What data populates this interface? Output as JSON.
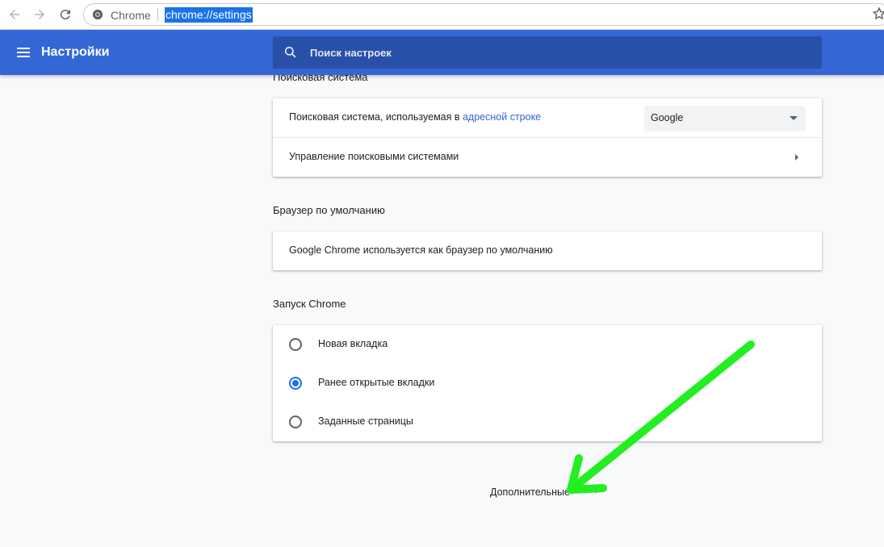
{
  "browser": {
    "site_name": "Chrome",
    "url": "chrome://settings"
  },
  "header": {
    "title": "Настройки",
    "search_placeholder": "Поиск настроек"
  },
  "search_engine": {
    "section_title": "Поисковая система",
    "row1_text": "Поисковая система, используемая в",
    "row1_link": "адресной строке",
    "select_value": "Google",
    "row2_text": "Управление поисковыми системами"
  },
  "default_browser": {
    "section_title": "Браузер по умолчанию",
    "text": "Google Chrome используется как браузер по умолчанию"
  },
  "startup": {
    "section_title": "Запуск Chrome",
    "options": [
      {
        "label": "Новая вкладка",
        "checked": false
      },
      {
        "label": "Ранее открытые вкладки",
        "checked": true
      },
      {
        "label": "Заданные страницы",
        "checked": false
      }
    ]
  },
  "advanced": {
    "label": "Дополнительные"
  },
  "colors": {
    "header_bg": "#3367d6",
    "search_bg": "#2850a8",
    "accent": "#1a73e8",
    "annotation_arrow": "#22ee22"
  }
}
